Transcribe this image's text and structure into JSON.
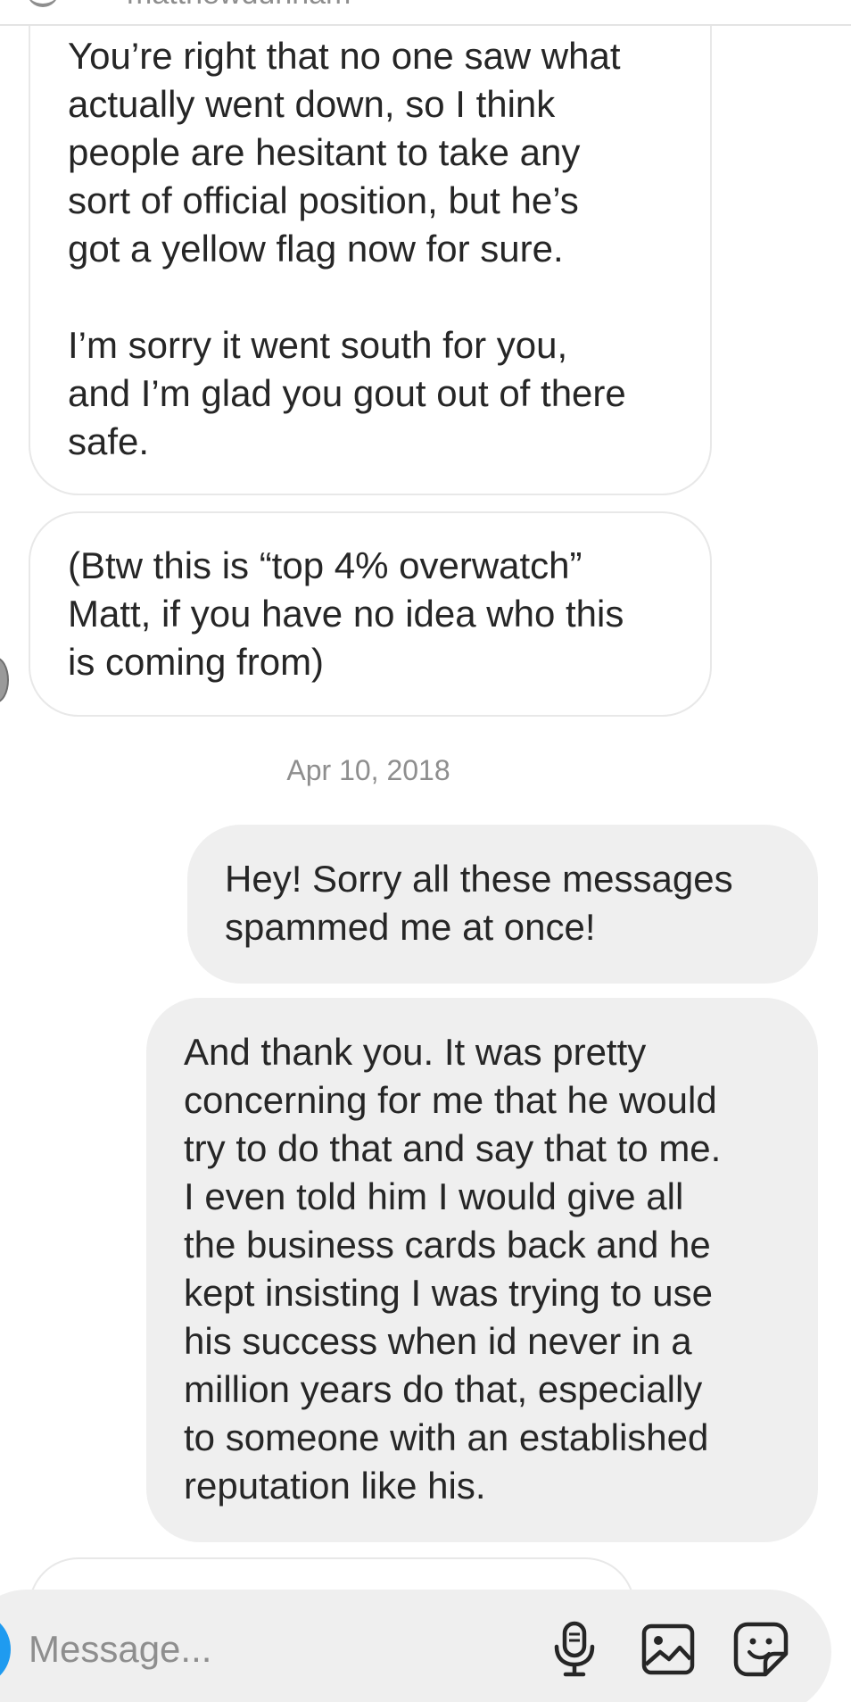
{
  "header": {
    "username": "matthewdunham"
  },
  "messages": [
    {
      "direction": "received",
      "text": "You’re right that no one saw what\nactually went down, so I think\npeople are hesitant to take any\nsort of official position, but he’s\ngot a yellow flag now for sure.\n\nI’m sorry it went south for you,\nand I’m glad you gout out of there\nsafe."
    },
    {
      "direction": "received",
      "text": "(Btw this is “top 4% overwatch”\nMatt, if you have no idea who this\nis coming from)"
    },
    {
      "direction": "sent",
      "text": "Hey! Sorry all these messages\nspammed me at once!"
    },
    {
      "direction": "sent",
      "text": "And thank you. It was pretty\nconcerning for me that he would\ntry to do that and say that to me.\nI even told him I would give all\nthe business cards back and he\nkept insisting I was trying to use\nhis success when id never in a\nmillion years do that, especially\nto someone with an established\nreputation like his."
    },
    {
      "direction": "received",
      "text": ""
    }
  ],
  "timestamp": "Apr 10, 2018",
  "composer": {
    "placeholder": "Message...",
    "icons": [
      "microphone-icon",
      "gallery-icon",
      "sticker-icon"
    ]
  },
  "colors": {
    "sent_bubble": "#efefef",
    "received_border": "#e8e8e8",
    "text": "#262626",
    "muted": "#8e8e8e",
    "accent": "#1f9bf0"
  }
}
